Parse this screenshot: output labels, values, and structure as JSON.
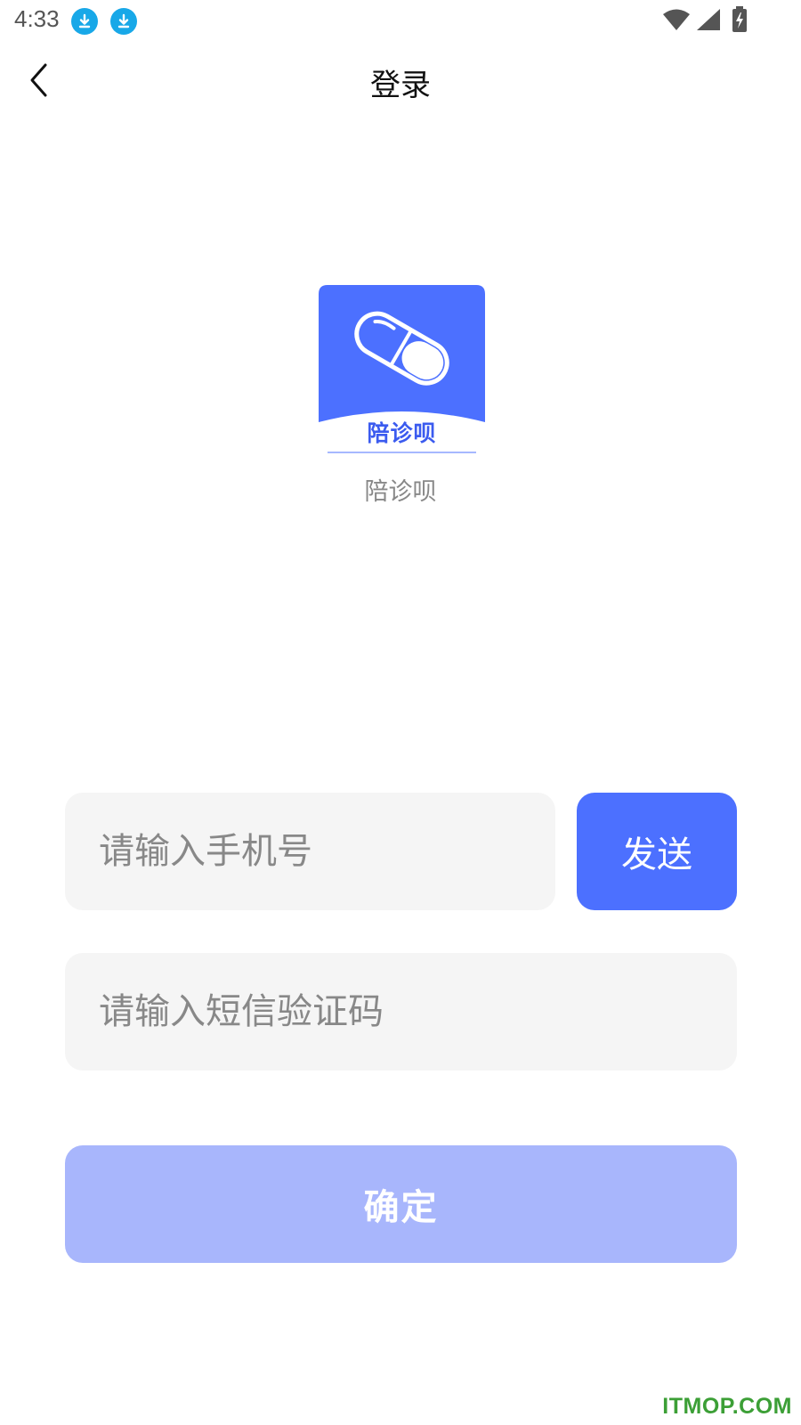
{
  "status_bar": {
    "time": "4:33",
    "left_icons": [
      "download-icon",
      "download-icon"
    ],
    "right_icons": [
      "wifi-icon",
      "signal-icon",
      "battery-charging-icon"
    ],
    "download_icon_color": "#18a8e8"
  },
  "header": {
    "back_icon": "chevron-left-icon",
    "title": "登录"
  },
  "logo": {
    "text": "陪诊呗",
    "icon": "capsule-icon",
    "background_color": "#4c70ff"
  },
  "app_name": "陪诊呗",
  "form": {
    "phone_placeholder": "请输入手机号",
    "phone_value": "",
    "send_label": "发送",
    "code_placeholder": "请输入短信验证码",
    "code_value": "",
    "confirm_label": "确定"
  },
  "colors": {
    "accent": "#4c70ff",
    "confirm_disabled": "#a8b6fc",
    "field_background": "#f5f5f5"
  },
  "watermark": "ITMOP.COM"
}
